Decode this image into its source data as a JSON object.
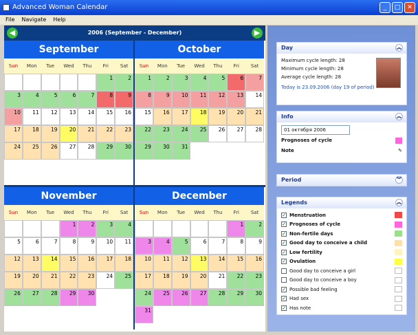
{
  "window": {
    "title": "Advanced Woman Calendar",
    "min": "_",
    "max": "□",
    "close": "✕"
  },
  "menu": [
    "File",
    "Navigate",
    "Help"
  ],
  "nav": {
    "title": "2006 (September - December)",
    "prev": "◀",
    "next": "▶"
  },
  "dow": [
    "Sun",
    "Mon",
    "Tue",
    "Wed",
    "Thu",
    "Fri",
    "Sat"
  ],
  "colors": {
    "menstruation": "#f04848",
    "prognosis": "#ff66dd",
    "nonfertile": "#99e088",
    "good_conceive": "#ffe0a6",
    "low_fertility": "#fff3c2",
    "ovulation": "#ffff44"
  },
  "months": [
    {
      "name": "September",
      "start": 5,
      "days": 30,
      "colors": {
        "1": "g",
        "2": "g",
        "3": "g",
        "4": "g",
        "5": "g",
        "6": "g",
        "7": "g",
        "8": "r",
        "9": "r",
        "10": "g",
        "11": "g",
        "12": "g",
        "13": "g",
        "14": "g",
        "15": "g",
        "16": "g",
        "17": "g",
        "18": "g",
        "19": "g",
        "20": "g",
        "21": "g",
        "22": "g",
        "23": "g",
        "24": "g",
        "25": "g",
        "26": "g",
        "27": "g",
        "28": "g",
        "29": "g",
        "30": "g"
      }
    },
    {
      "name": "October",
      "start": 0,
      "days": 31
    },
    {
      "name": "November",
      "start": 3,
      "days": 30
    },
    {
      "name": "December",
      "start": 5,
      "days": 31
    }
  ],
  "day_panel": {
    "title": "Day",
    "max_cycle": "Maximum cycle length: 28",
    "min_cycle": "Minimum cycle length: 28",
    "avg_cycle": "Average cycle length: 28",
    "today": "Today is 23.09.2006 (day 19 of period)"
  },
  "info_panel": {
    "title": "Info",
    "date": "01 октября 2006",
    "prognosis": "Prognoses of cycle",
    "note": "Note"
  },
  "period_panel": {
    "title": "Period"
  },
  "legends": {
    "title": "Legends",
    "items": [
      {
        "name": "Menstruation",
        "checked": true,
        "color": "#f04848"
      },
      {
        "name": "Prognoses of cycle",
        "checked": true,
        "color": "#ff66dd"
      },
      {
        "name": "Non-fertile days",
        "checked": true,
        "color": "#99e088"
      },
      {
        "name": "Good day to conceive a child",
        "checked": true,
        "color": "#ffe0a6"
      },
      {
        "name": "Low fertility",
        "checked": true,
        "color": "#fff3c2"
      },
      {
        "name": "Ovulation",
        "checked": true,
        "color": "#ffff44"
      },
      {
        "name": "Good day to conceive a girl",
        "checked": false,
        "color": "#ffffff"
      },
      {
        "name": "Good day to conceive a boy",
        "checked": false,
        "color": "#ffffff"
      },
      {
        "name": "Possible bad feeling",
        "checked": true,
        "color": "#ffffff"
      },
      {
        "name": "Had sex",
        "checked": true,
        "color": "#ffffff"
      },
      {
        "name": "Has note",
        "checked": true,
        "color": "#ffffff"
      }
    ]
  }
}
